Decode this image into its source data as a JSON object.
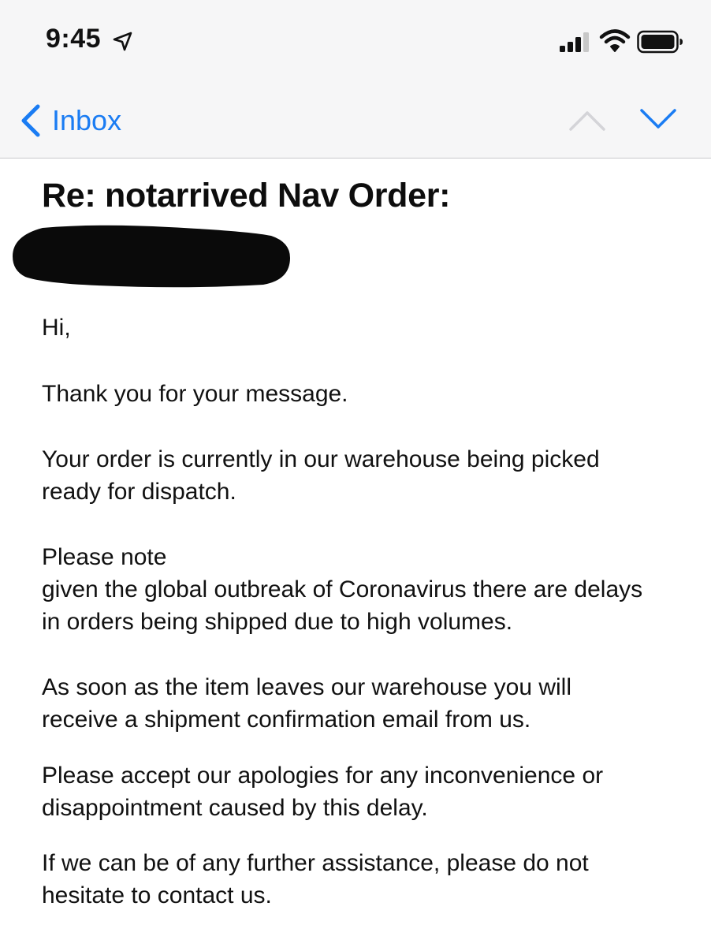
{
  "status_bar": {
    "time": "9:45"
  },
  "nav": {
    "back_label": "Inbox",
    "accent_color": "#1a7cf3"
  },
  "email": {
    "subject": "Re: notarrived Nav Order:",
    "paragraphs": [
      "Hi,",
      "Thank you for your message.",
      "Your order is currently in our warehouse being picked ready for dispatch.",
      "Please note",
      "given the global outbreak of Coronavirus there are delays in orders being shipped due to high volumes.",
      "As soon as the item leaves our warehouse you will receive a shipment confirmation email from us.",
      "Please accept our apologies for any inconvenience or disappointment caused by this delay.",
      "If we can be of any further assistance, please do not hesitate to contact us."
    ]
  },
  "icons": {
    "status": [
      "location-arrow-icon",
      "cellular-signal-icon",
      "wifi-icon",
      "battery-icon"
    ],
    "nav": [
      "chevron-left-icon",
      "chevron-up-icon",
      "chevron-down-icon"
    ]
  }
}
